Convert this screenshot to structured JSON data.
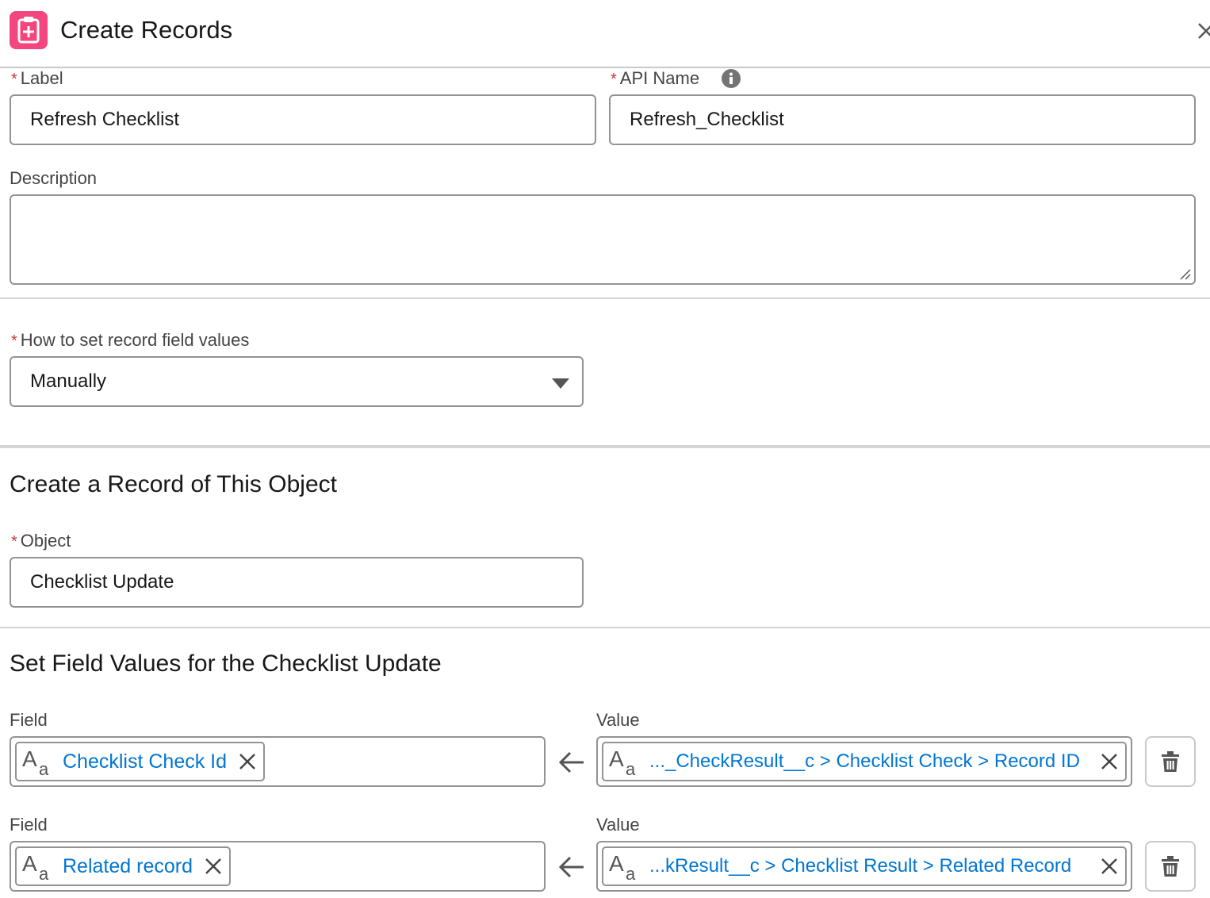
{
  "header": {
    "title": "Create Records",
    "icon": "create-record-icon",
    "accent": "#f4467e"
  },
  "form": {
    "label": {
      "label": "Label",
      "value": "Refresh Checklist"
    },
    "api_name": {
      "label": "API Name",
      "value": "Refresh_Checklist",
      "info_icon": "info-icon"
    },
    "description": {
      "label": "Description",
      "value": ""
    },
    "how_to_set": {
      "label": "How to set record field values",
      "value": "Manually"
    }
  },
  "object_section": {
    "title": "Create a Record of This Object",
    "object": {
      "label": "Object",
      "value": "Checklist Update"
    }
  },
  "field_values": {
    "title": "Set Field Values for the Checklist Update",
    "rows": [
      {
        "field_label": "Field",
        "field": "Checklist Check Id",
        "value_label": "Value",
        "value": "..._CheckResult__c > Checklist Check > Record ID"
      },
      {
        "field_label": "Field",
        "field": "Related record",
        "value_label": "Value",
        "value": "...kResult__c > Checklist Result > Related Record"
      }
    ]
  },
  "colors": {
    "link": "#0176d3",
    "required": "#c23934",
    "border": "#939393"
  }
}
